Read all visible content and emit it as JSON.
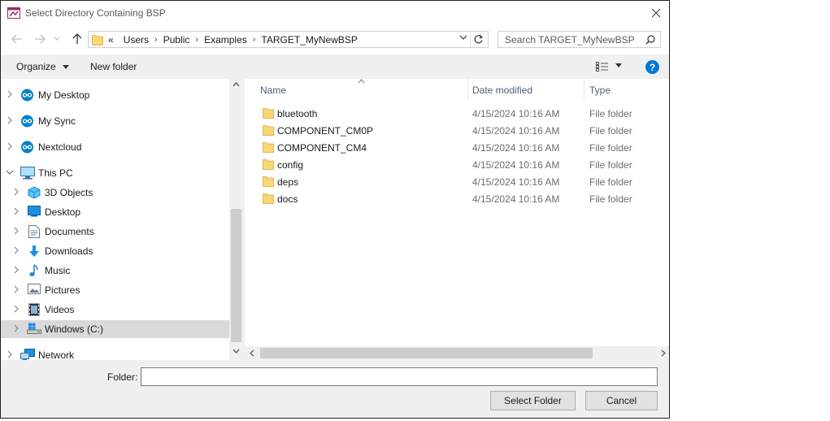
{
  "window": {
    "title": "Select Directory Containing BSP"
  },
  "address": {
    "overflow": "«",
    "crumbs": [
      "Users",
      "Public",
      "Examples",
      "TARGET_MyNewBSP"
    ]
  },
  "search": {
    "placeholder": "Search TARGET_MyNewBSP"
  },
  "toolbar": {
    "organize_label": "Organize",
    "new_folder_label": "New folder"
  },
  "nav": {
    "items": [
      {
        "label": "My Desktop",
        "icon": "cloud-sync-icon"
      },
      {
        "label": "My Sync",
        "icon": "cloud-sync-icon"
      },
      {
        "label": "Nextcloud",
        "icon": "cloud-sync-icon"
      },
      {
        "label": "This PC",
        "icon": "computer-icon"
      },
      {
        "label": "3D Objects",
        "icon": "3d-objects-icon"
      },
      {
        "label": "Desktop",
        "icon": "desktop-icon"
      },
      {
        "label": "Documents",
        "icon": "documents-icon"
      },
      {
        "label": "Downloads",
        "icon": "downloads-icon"
      },
      {
        "label": "Music",
        "icon": "music-icon"
      },
      {
        "label": "Pictures",
        "icon": "pictures-icon"
      },
      {
        "label": "Videos",
        "icon": "videos-icon"
      },
      {
        "label": "Windows (C:)",
        "icon": "drive-icon"
      },
      {
        "label": "Network",
        "icon": "network-icon"
      }
    ]
  },
  "columns": {
    "name": "Name",
    "date": "Date modified",
    "type": "Type"
  },
  "files": [
    {
      "name": "bluetooth",
      "date": "4/15/2024 10:16 AM",
      "type": "File folder"
    },
    {
      "name": "COMPONENT_CM0P",
      "date": "4/15/2024 10:16 AM",
      "type": "File folder"
    },
    {
      "name": "COMPONENT_CM4",
      "date": "4/15/2024 10:16 AM",
      "type": "File folder"
    },
    {
      "name": "config",
      "date": "4/15/2024 10:16 AM",
      "type": "File folder"
    },
    {
      "name": "deps",
      "date": "4/15/2024 10:16 AM",
      "type": "File folder"
    },
    {
      "name": "docs",
      "date": "4/15/2024 10:16 AM",
      "type": "File folder"
    }
  ],
  "footer": {
    "folder_label": "Folder:",
    "folder_value": "",
    "select_label": "Select Folder",
    "cancel_label": "Cancel"
  },
  "colors": {
    "accent": "#0078d7",
    "folder": "#f8d775",
    "selected": "#d9d9d9"
  }
}
